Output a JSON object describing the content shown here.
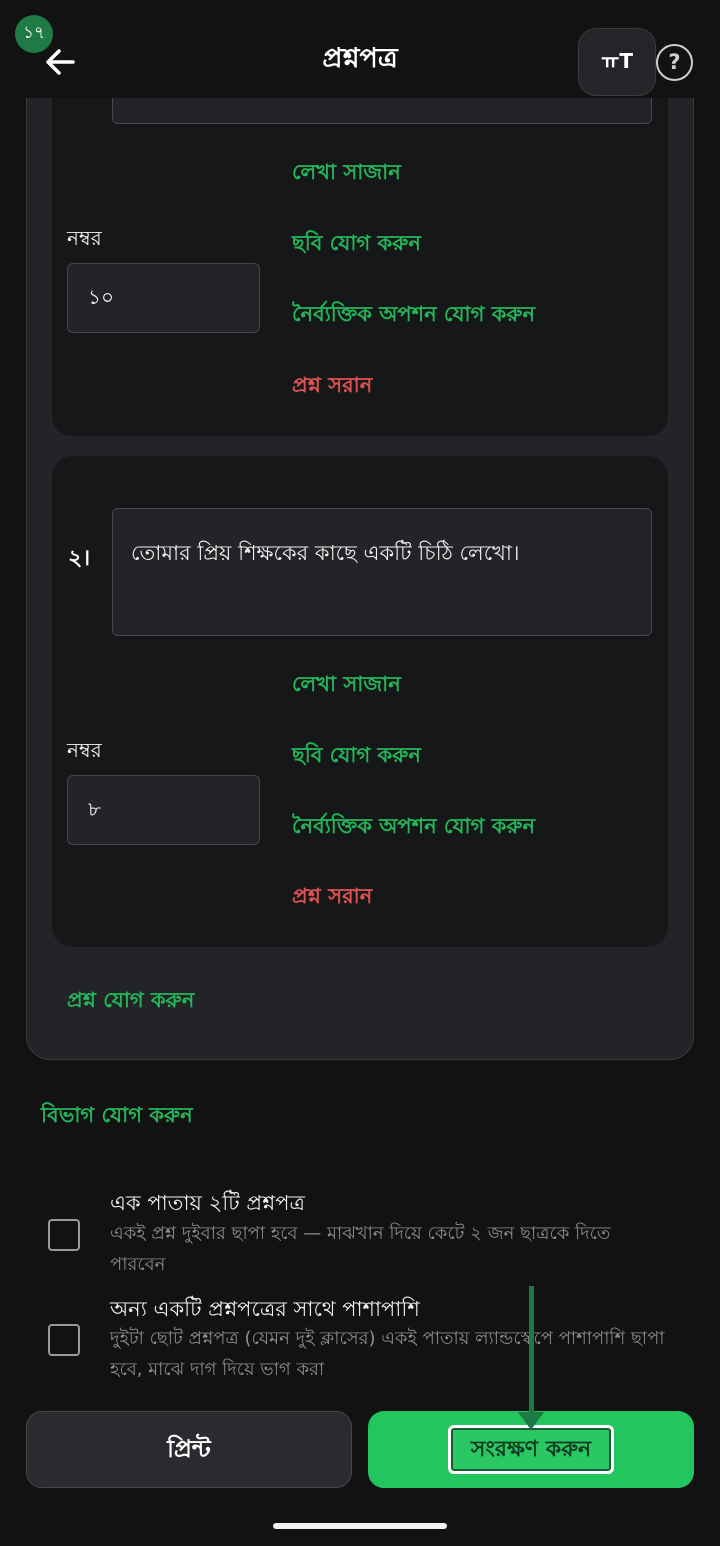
{
  "status_badge": "১৭",
  "header": {
    "title": "প্রশ্নপত্র",
    "text_size_label": "ㅠT",
    "help_label": "?"
  },
  "questions": [
    {
      "number_label": "নম্বর",
      "marks": "১০",
      "actions": {
        "format": "লেখা সাজান",
        "add_image": "ছবি যোগ করুন",
        "add_mcq": "নৈর্ব্যক্তিক অপশন যোগ করুন",
        "remove": "প্রশ্ন সরান"
      }
    },
    {
      "index": "২।",
      "text": "তোমার প্রিয় শিক্ষকের কাছে একটি চিঠি লেখো।",
      "number_label": "নম্বর",
      "marks": "৮",
      "actions": {
        "format": "লেখা সাজান",
        "add_image": "ছবি যোগ করুন",
        "add_mcq": "নৈর্ব্যক্তিক অপশন যোগ করুন",
        "remove": "প্রশ্ন সরান"
      }
    }
  ],
  "add_question": "প্রশ্ন যোগ করুন",
  "add_section": "বিভাগ যোগ করুন",
  "options": [
    {
      "title": "এক পাতায় ২টি প্রশ্নপত্র",
      "description": "একই প্রশ্ন দুইবার ছাপা হবে — মাঝখান দিয়ে কেটে ২ জন ছাত্রকে দিতে পারবেন",
      "checked": false
    },
    {
      "title": "অন্য একটি প্রশ্নপত্রের সাথে পাশাপাশি",
      "description": "দুইটা ছোট প্রশ্নপত্র (যেমন দুই ক্লাসের) একই পাতায় ল্যান্ডস্কেপে পাশাপাশি ছাপা হবে, মাঝে দাগ দিয়ে ভাগ করা",
      "checked": false
    }
  ],
  "buttons": {
    "print": "প্রিন্ট",
    "save": "সংরক্ষণ করুন"
  },
  "colors": {
    "accent_green": "#24b55a",
    "danger_red": "#e05151",
    "save_button": "#22c55e"
  }
}
